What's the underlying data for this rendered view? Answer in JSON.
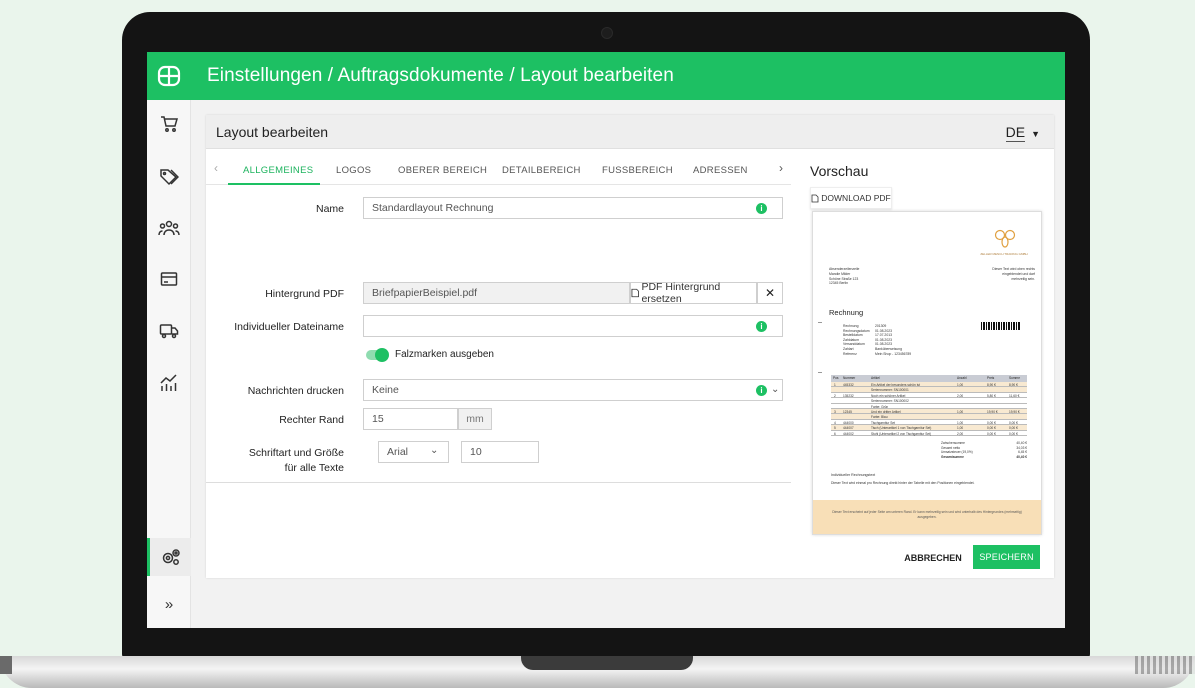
{
  "header": {
    "title": "Einstellungen / Auftragsdokumente / Layout bearbeiten",
    "accent_color": "#1dc063"
  },
  "sidebar": {
    "items": [
      {
        "icon": "cart-icon"
      },
      {
        "icon": "tags-icon"
      },
      {
        "icon": "users-icon"
      },
      {
        "icon": "credit-card-icon"
      },
      {
        "icon": "truck-icon"
      },
      {
        "icon": "chart-icon"
      },
      {
        "icon": "settings-gears-icon",
        "active": true
      },
      {
        "icon": "expand-icon",
        "label": "»"
      }
    ]
  },
  "panel": {
    "title": "Layout bearbeiten",
    "language": "DE"
  },
  "tabs": [
    {
      "label": "ALLGEMEINES",
      "active": true
    },
    {
      "label": "LOGOS"
    },
    {
      "label": "OBERER BEREICH"
    },
    {
      "label": "DETAILBEREICH"
    },
    {
      "label": "FUSSBEREICH"
    },
    {
      "label": "ADRESSEN"
    }
  ],
  "form": {
    "name": {
      "label": "Name",
      "value": "Standardlayout Rechnung"
    },
    "background_pdf": {
      "label": "Hintergrund PDF",
      "value": "BriefpapierBeispiel.pdf",
      "replace_label": "PDF Hintergrund ersetzen",
      "remove_label": "✕"
    },
    "filename": {
      "label": "Individueller Dateiname",
      "value": ""
    },
    "fold_marks": {
      "label": "Falzmarken ausgeben",
      "checked": true
    },
    "print_messages": {
      "label": "Nachrichten drucken",
      "value": "Keine"
    },
    "right_margin": {
      "label": "Rechter Rand",
      "value": "15",
      "unit": "mm"
    },
    "font": {
      "label_line1": "Schriftart und Größe",
      "label_line2": "für alle Texte",
      "family": "Arial",
      "size": "10"
    }
  },
  "preview": {
    "title": "Vorschau",
    "download_label": "DOWNLOAD PDF",
    "document": {
      "company": "ZELLER MENCH TRADING GMBH",
      "sender": [
        "Absenderzeilenzeile",
        "Mandie Milder",
        "Schöne Straße 123",
        "12345 Berlin"
      ],
      "right_note": [
        "Dieser Text wird oben rechts",
        "eingeblendet und darf",
        "mehrzeilig sein."
      ],
      "heading": "Rechnung",
      "meta": [
        [
          "Rechnung",
          "201309"
        ],
        [
          "Rechnungsdatum",
          "01.08.2023"
        ],
        [
          "Bestelldatum",
          "17.07.2013"
        ],
        [
          "Zahldatum",
          "01.08.2023"
        ],
        [
          "Versanddatum",
          "01.08.2023"
        ],
        [
          "Zahlart",
          "Banküberweisung"
        ],
        [
          "Referenz",
          "Mein Shop - 123456789"
        ]
      ],
      "table_headers": [
        "Pos",
        "Nummer",
        "Artikel",
        "Anzahl",
        "Preis",
        "Summe"
      ],
      "rows": [
        [
          "1",
          "445332",
          "Ein Artikel der besonders schön ist",
          "1,00",
          "8,90 €",
          "8,90 €"
        ],
        [
          "",
          "",
          "Seriennummer: SN100001",
          "",
          "",
          ""
        ],
        [
          "2",
          "135232",
          "Noch ein schöner Artikel",
          "2,00",
          "5,80 €",
          "11,60 €"
        ],
        [
          "",
          "",
          "Seriennummer: SN100002",
          "",
          "",
          ""
        ],
        [
          "",
          "",
          "Farbe: Grün",
          "",
          "",
          ""
        ],
        [
          "3",
          "12345",
          "Und ein dritter Artikel",
          "1,00",
          "19,90 €",
          "19,90 €"
        ],
        [
          "",
          "",
          "Farbe: Blau",
          "",
          "",
          ""
        ],
        [
          "4",
          "444000",
          "Tischgarnitur Set",
          "1,00",
          "0,00 €",
          "0,00 €"
        ],
        [
          "5",
          "444007",
          "Tisch (Unterartikel 1 von Tischgarnitur Set)",
          "1,00",
          "0,00 €",
          "0,00 €"
        ],
        [
          "6",
          "444002",
          "Stuhl (Unterartikel 2 von Tischgarnitur Set)",
          "2,00",
          "0,00 €",
          "0,00 €"
        ]
      ],
      "totals": [
        [
          "Zwischensumme",
          "40,40 €"
        ],
        [
          "Gesamt netto",
          "34,03 €"
        ],
        [
          "Umsatzsteuer (19,0%)",
          "6,45 €"
        ],
        [
          "Gesamtsumme",
          "40,40 €"
        ]
      ],
      "individual_title": "Individueller Rechnungstext",
      "individual_text": "Dieser Text wird einmal pro Rechnung direkt hinter der Tabelle mit den Positionen eingeblendet.",
      "footer_text": "Dieser Text erscheint auf jeder Seite am unteren Rand. Er kann mehrzeilig sein und wird unterhalb des Hintergrundes (mehrseitig) ausgegeben."
    }
  },
  "actions": {
    "cancel": "ABBRECHEN",
    "save": "SPEICHERN"
  }
}
